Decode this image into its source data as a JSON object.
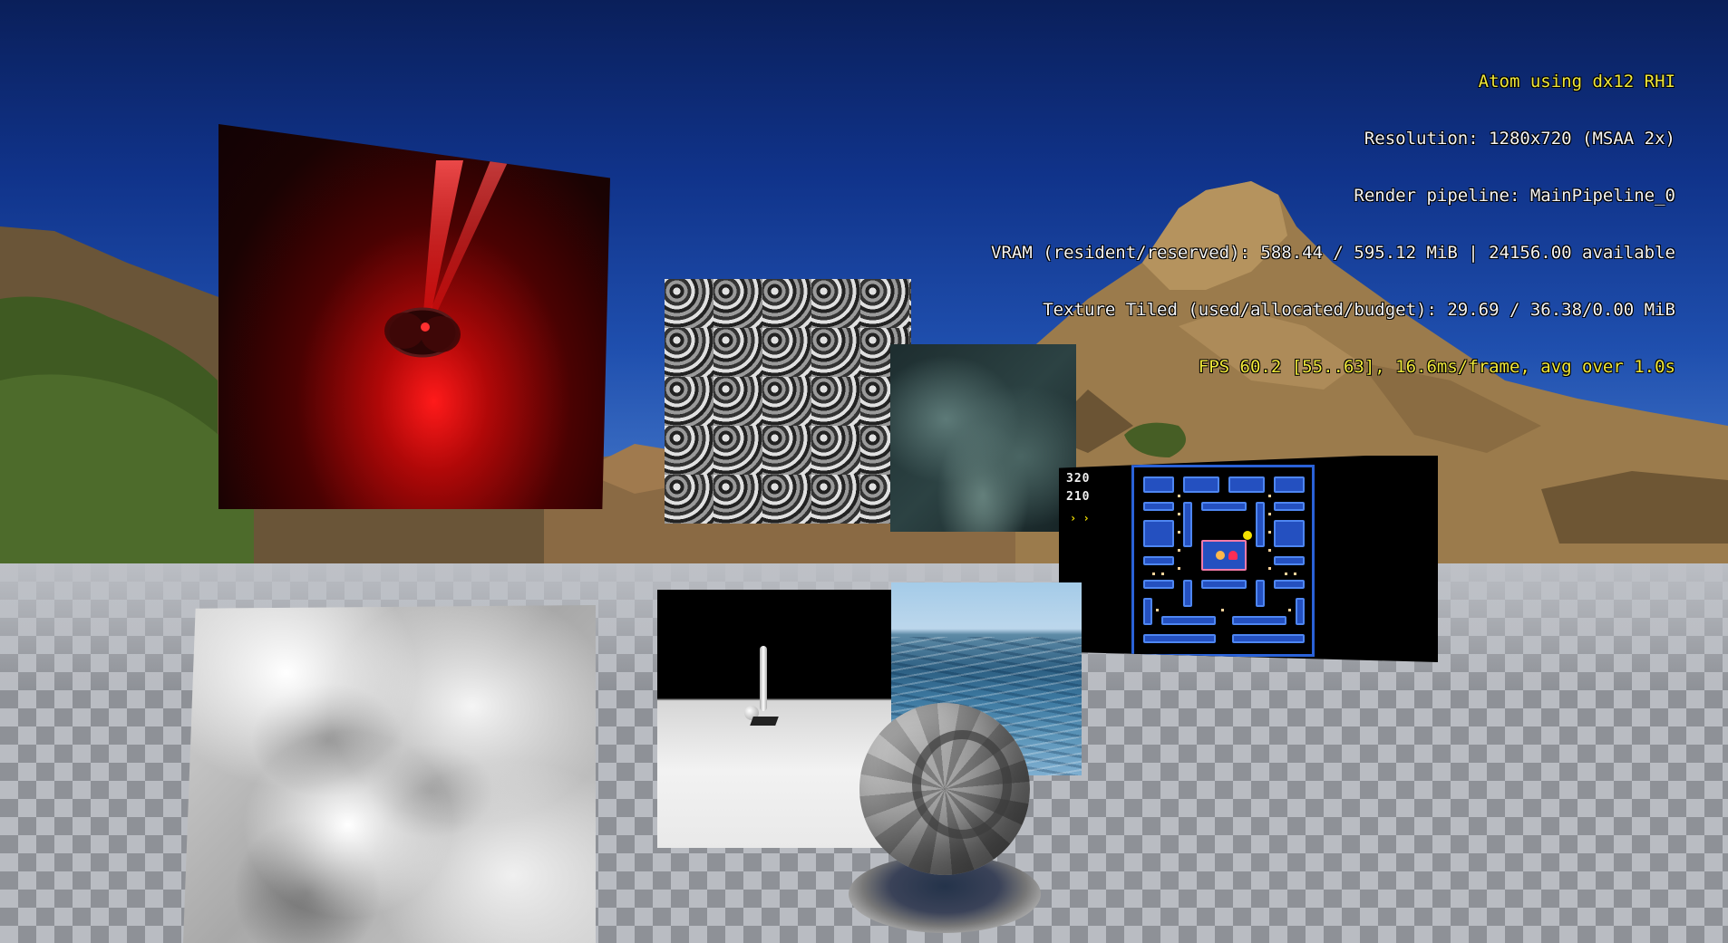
{
  "hud": {
    "rhi": "Atom using dx12 RHI",
    "resolution": "Resolution: 1280x720 (MSAA 2x)",
    "pipeline": "Render pipeline: MainPipeline_0",
    "vram": "VRAM (resident/reserved): 588.44 / 595.12 MiB | 24156.00 available",
    "texture": "Texture Tiled (used/allocated/budget): 29.69 / 36.38/0.00 MiB",
    "fps": "FPS 60.2 [55..63], 16.6ms/frame, avg over 1.0s"
  },
  "colors": {
    "hud_highlight": "#f0e83a",
    "hud_text": "#f4f4f4",
    "sky_top": "#0a1f5a",
    "sky_horizon": "#6a93cf",
    "laser": "#ff1a1a",
    "pacman_wall": "#2a62d8"
  },
  "pacman": {
    "score_1": "320",
    "score_2": "210",
    "lives": "› ›"
  },
  "panels": [
    {
      "name": "laser-panel",
      "content": "red laser scene"
    },
    {
      "name": "rings-panel",
      "content": "circle pattern texture"
    },
    {
      "name": "marble-panel",
      "content": "dark marble texture"
    },
    {
      "name": "pacman-panel",
      "content": "Pac-Man game"
    },
    {
      "name": "clouds-panel",
      "content": "cloud noise texture"
    },
    {
      "name": "shadow-panel",
      "content": "shadow scene"
    },
    {
      "name": "ocean-panel",
      "content": "ocean scene"
    }
  ]
}
